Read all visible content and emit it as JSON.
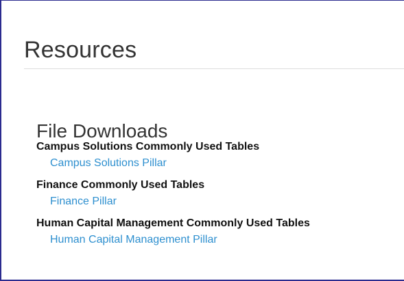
{
  "page": {
    "title": "Resources"
  },
  "file_downloads": {
    "title": "File Downloads",
    "groups": [
      {
        "heading": "Campus Solutions Commonly Used Tables",
        "link": "Campus Solutions Pillar"
      },
      {
        "heading": "Finance Commonly Used Tables",
        "link": "Finance Pillar"
      },
      {
        "heading": "Human Capital Management Commonly Used Tables",
        "link": "Human Capital Management Pillar"
      }
    ]
  },
  "colors": {
    "link": "#2d8fcf",
    "border": "#2b2b8f",
    "divider": "#dcdcdc"
  }
}
